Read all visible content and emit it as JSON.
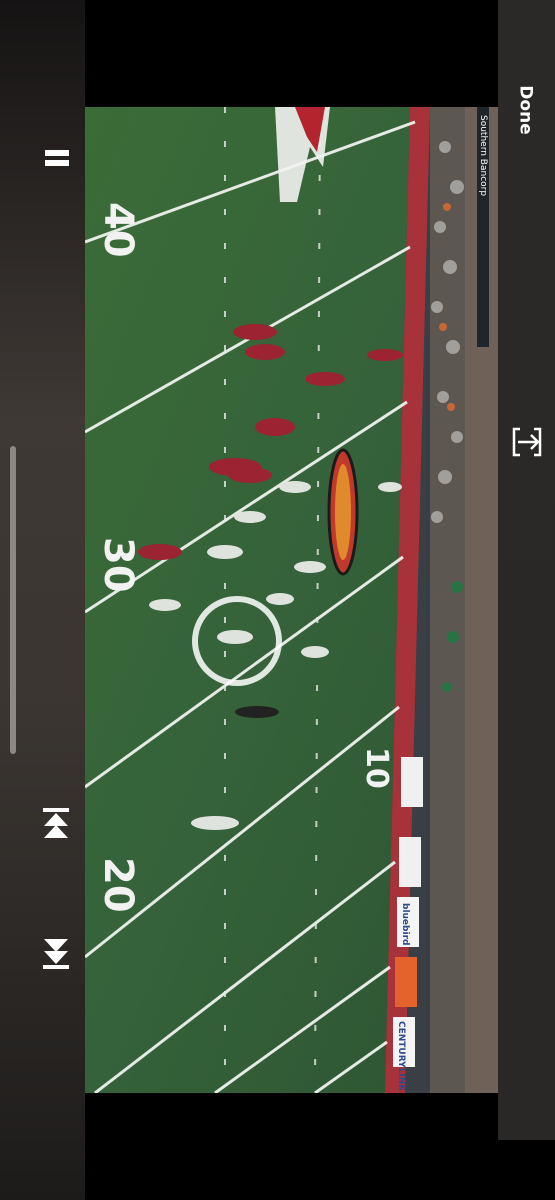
{
  "player": {
    "done_label": "Done",
    "controls": [
      "pause-icon",
      "skip-back-icon",
      "skip-forward-icon",
      "share-icon"
    ]
  },
  "field": {
    "yard_numbers": [
      "40",
      "30",
      "20",
      "10"
    ],
    "stadium_signs": [
      "Southern Bancorp",
      "bluebird",
      "CENTURYLINK"
    ],
    "colors": {
      "turf": "#3c6e38",
      "turf_dark": "#2f5a2c",
      "lines": "#f2f2f2",
      "home_team": "#9b2430",
      "away_team": "#d8ddd6",
      "sideline": "#a8323a"
    }
  }
}
